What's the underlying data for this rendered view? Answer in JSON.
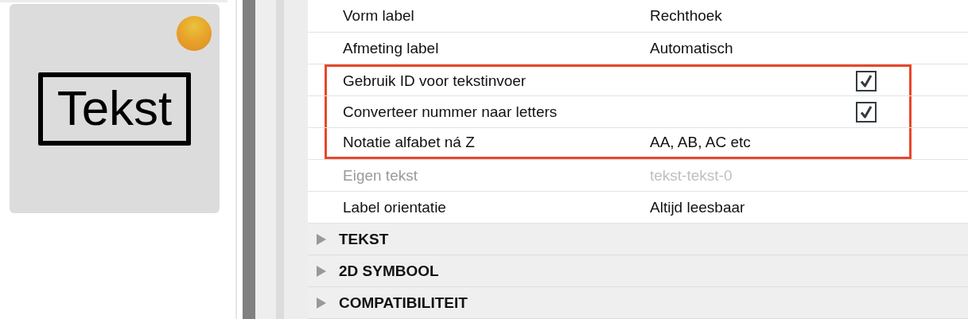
{
  "preview": {
    "label": "Tekst"
  },
  "properties": [
    {
      "kind": "value",
      "label": "Vorm label",
      "value": "Rechthoek",
      "disabled": false,
      "highlighted": false
    },
    {
      "kind": "value",
      "label": "Afmeting label",
      "value": "Automatisch",
      "disabled": false,
      "highlighted": false
    },
    {
      "kind": "checkbox",
      "label": "Gebruik ID voor tekstinvoer",
      "checked": true,
      "disabled": false,
      "highlighted": true
    },
    {
      "kind": "checkbox",
      "label": "Converteer nummer naar letters",
      "checked": true,
      "disabled": false,
      "highlighted": true
    },
    {
      "kind": "value",
      "label": "Notatie alfabet ná Z",
      "value": "AA, AB, AC etc",
      "disabled": false,
      "highlighted": true
    },
    {
      "kind": "value",
      "label": "Eigen tekst",
      "value": "tekst-tekst-0",
      "disabled": true,
      "highlighted": false
    },
    {
      "kind": "value",
      "label": "Label orientatie",
      "value": "Altijd leesbaar",
      "disabled": false,
      "highlighted": false
    }
  ],
  "sections": [
    {
      "title": "TEKST",
      "expanded": false
    },
    {
      "title": "2D SYMBOOL",
      "expanded": false
    },
    {
      "title": "COMPATIBILITEIT",
      "expanded": false
    }
  ]
}
